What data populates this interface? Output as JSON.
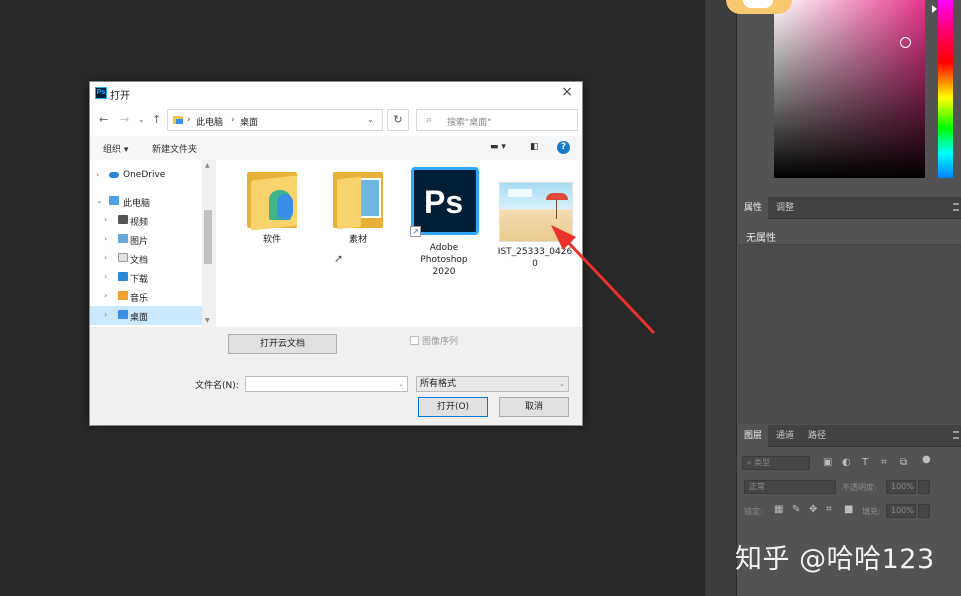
{
  "photoshop": {
    "properties_panel": {
      "tabs": [
        "属性",
        "调整"
      ],
      "empty_text": "无属性"
    },
    "layers_panel": {
      "tabs": [
        "图层",
        "通道",
        "路径"
      ],
      "filter_placeholder": "类型",
      "blend_mode": "正常",
      "opacity_label": "不透明度:",
      "opacity_value": "100%",
      "lock_label": "锁定:",
      "fill_label": "填充:",
      "fill_value": "100%"
    }
  },
  "dialog": {
    "title": "打开",
    "app_badge": "Ps",
    "address": {
      "segments": [
        "此电脑",
        "桌面"
      ]
    },
    "search_placeholder": "搜索\"桌面\"",
    "toolbar": {
      "organize": "组织",
      "new_folder": "新建文件夹"
    },
    "nav_items": [
      {
        "label": "OneDrive",
        "icon": "cloud-icon"
      },
      {
        "label": "此电脑",
        "icon": "computer-icon"
      },
      {
        "label": "视频",
        "icon": "video-folder-icon"
      },
      {
        "label": "图片",
        "icon": "pictures-folder-icon"
      },
      {
        "label": "文档",
        "icon": "documents-folder-icon"
      },
      {
        "label": "下载",
        "icon": "downloads-folder-icon"
      },
      {
        "label": "音乐",
        "icon": "music-folder-icon"
      },
      {
        "label": "桌面",
        "icon": "desktop-folder-icon"
      }
    ],
    "files": [
      {
        "label": "软件",
        "type": "folder"
      },
      {
        "label": "素材",
        "type": "folder"
      },
      {
        "label_lines": [
          "Adobe",
          "Photoshop",
          "2020"
        ],
        "type": "shortcut"
      },
      {
        "label_lines": [
          "IST_25333_0426",
          "0"
        ],
        "type": "image"
      }
    ],
    "ps_icon_text": "Ps",
    "open_cloud_button": "打开云文档",
    "image_sequence_label": "图像序列",
    "filename_label": "文件名(N):",
    "filename_value": "",
    "filetype_value": "所有格式",
    "open_button": "打开(O)",
    "cancel_button": "取消"
  },
  "watermark": "知乎 @哈哈123",
  "colors": {
    "ps_background": "#282828",
    "annotation_arrow": "#e8322a",
    "selected_nav": "#cce8ff",
    "ps_blue": "#31a8ff"
  }
}
